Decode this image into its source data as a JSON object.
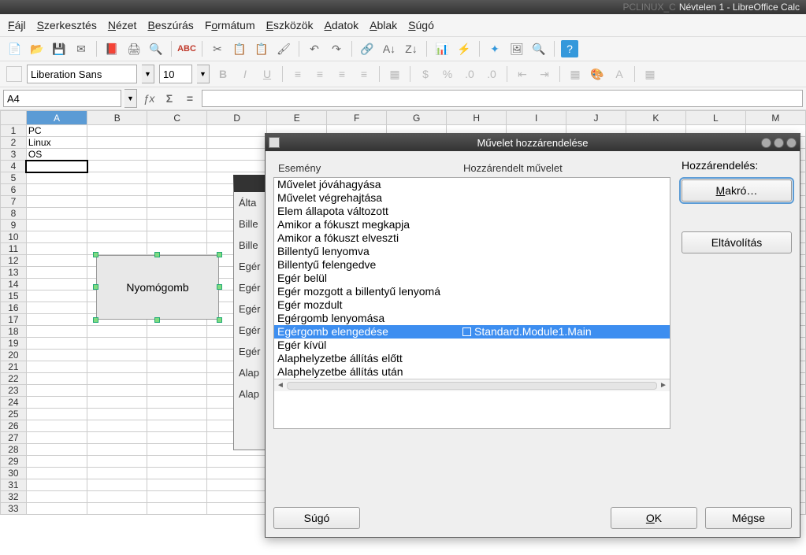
{
  "window": {
    "bg_text": "PCLINUX_C",
    "title": "Névtelen 1 - LibreOffice Calc"
  },
  "menu": {
    "file": "Fájl",
    "edit": "Szerkesztés",
    "view": "Nézet",
    "insert": "Beszúrás",
    "format": "Formátum",
    "tools": "Eszközök",
    "data": "Adatok",
    "window": "Ablak",
    "help": "Súgó"
  },
  "font": {
    "name": "Liberation Sans",
    "size": "10"
  },
  "cellref": "A4",
  "columns": [
    "A",
    "B",
    "C",
    "D",
    "E",
    "F",
    "G",
    "H",
    "I",
    "J",
    "K",
    "L",
    "M"
  ],
  "cells": {
    "a1": "PC",
    "a2": "Linux",
    "a3": "OS"
  },
  "button_shape": {
    "label": "Nyomógomb"
  },
  "hidden_dialog": {
    "r0": "Álta",
    "r1": "Bille",
    "r2": "Bille",
    "r3": "Egér",
    "r4": "Egér",
    "r5": "Egér",
    "r6": "Egér",
    "r7": "Egér",
    "r8": "Alap",
    "r9": "Alap"
  },
  "dialog": {
    "title": "Művelet hozzárendelése",
    "col_event": "Esemény",
    "col_action": "Hozzárendelt művelet",
    "assign_label": "Hozzárendelés:",
    "macro_btn": "Makró…",
    "remove_btn": "Eltávolítás",
    "help_btn": "Súgó",
    "ok_btn": "OK",
    "cancel_btn": "Mégse",
    "events": [
      {
        "name": "Művelet jóváhagyása",
        "action": ""
      },
      {
        "name": "Művelet végrehajtása",
        "action": ""
      },
      {
        "name": "Elem állapota változott",
        "action": ""
      },
      {
        "name": "Amikor a fókuszt megkapja",
        "action": ""
      },
      {
        "name": "Amikor a fókuszt elveszti",
        "action": ""
      },
      {
        "name": "Billentyű lenyomva",
        "action": ""
      },
      {
        "name": "Billentyű felengedve",
        "action": ""
      },
      {
        "name": "Egér belül",
        "action": ""
      },
      {
        "name": "Egér mozgott a billentyű lenyomá",
        "action": ""
      },
      {
        "name": "Egér mozdult",
        "action": ""
      },
      {
        "name": "Egérgomb lenyomása",
        "action": ""
      },
      {
        "name": "Egérgomb elengedése",
        "action": "Standard.Module1.Main",
        "selected": true
      },
      {
        "name": "Egér kívül",
        "action": ""
      },
      {
        "name": "Alaphelyzetbe állítás előtt",
        "action": ""
      },
      {
        "name": "Alaphelyzetbe állítás után",
        "action": ""
      }
    ]
  }
}
